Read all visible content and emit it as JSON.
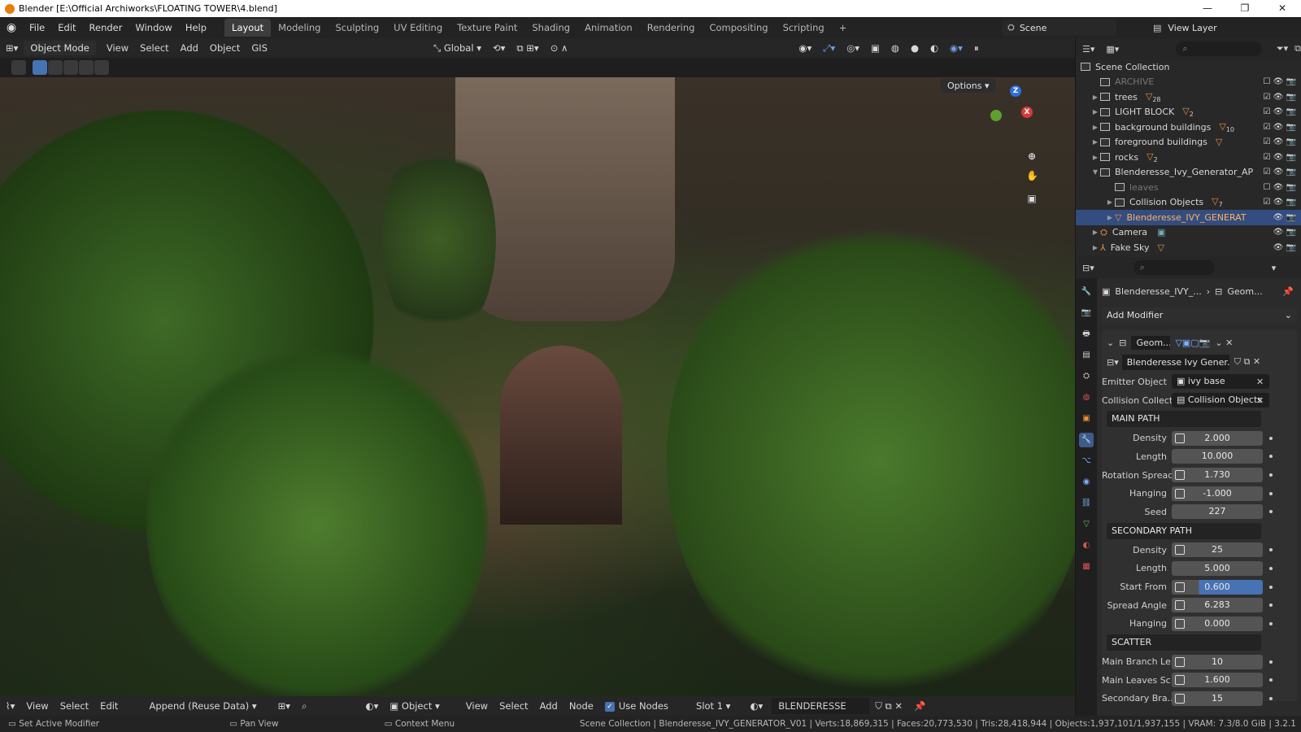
{
  "window": {
    "title": "Blender [E:\\Official Archiworks\\FLOATING TOWER\\4.blend]",
    "controls": [
      "—",
      "❐",
      "✕"
    ]
  },
  "menu": [
    "File",
    "Edit",
    "Render",
    "Window",
    "Help"
  ],
  "workspace_tabs": [
    {
      "label": "Layout",
      "active": true
    },
    {
      "label": "Modeling"
    },
    {
      "label": "Sculpting"
    },
    {
      "label": "UV Editing"
    },
    {
      "label": "Texture Paint"
    },
    {
      "label": "Shading"
    },
    {
      "label": "Animation"
    },
    {
      "label": "Rendering"
    },
    {
      "label": "Compositing"
    },
    {
      "label": "Scripting"
    },
    {
      "label": "+"
    }
  ],
  "scene": {
    "label": "Scene"
  },
  "view_layer": {
    "label": "View Layer"
  },
  "viewport_header": {
    "mode": "Object Mode",
    "menus": [
      "View",
      "Select",
      "Add",
      "Object",
      "GIS"
    ],
    "transform_orientation": "Global",
    "options_label": "Options"
  },
  "outliner": {
    "root": "Scene Collection",
    "rows": [
      {
        "label": "ARCHIVE",
        "dim": true
      },
      {
        "label": "trees",
        "count": "28"
      },
      {
        "label": "LIGHT BLOCK",
        "count": "2"
      },
      {
        "label": "background buildings",
        "count": "10"
      },
      {
        "label": "foreground buildings",
        "count": ""
      },
      {
        "label": "rocks",
        "count": "2"
      },
      {
        "label": "Blenderesse_Ivy_Generator_AP",
        "count": ""
      },
      {
        "label": "leaves",
        "dim": true
      },
      {
        "label": "Collision Objects",
        "count": "7"
      },
      {
        "label": "Blenderesse_IVY_GENERAT",
        "selected": true
      },
      {
        "label": "Camera",
        "count": ""
      },
      {
        "label": "Fake Sky",
        "count": ""
      }
    ]
  },
  "properties": {
    "breadcrumb_object": "Blenderesse_IVY_...",
    "breadcrumb_modifier": "Geom...",
    "add_modifier": "Add Modifier",
    "modifier_name": "Geom...",
    "node_group": "Blenderesse Ivy Gener...",
    "emitter_label": "Emitter Object",
    "emitter_value": "ivy base",
    "collision_label": "Collision Collect...",
    "collision_value": "Collision Objects",
    "sections": [
      {
        "title": "MAIN PATH",
        "fields": [
          {
            "label": "Density",
            "value": "2.000",
            "knob": true
          },
          {
            "label": "Length",
            "value": "10.000",
            "knob": false
          },
          {
            "label": "Rotation Spread",
            "value": "1.730",
            "knob": true
          },
          {
            "label": "Hanging",
            "value": "-1.000",
            "knob": true
          },
          {
            "label": "Seed",
            "value": "227",
            "knob": false
          }
        ]
      },
      {
        "title": "SECONDARY PATH",
        "fields": [
          {
            "label": "Density",
            "value": "25",
            "knob": true
          },
          {
            "label": "Length",
            "value": "5.000",
            "knob": false
          },
          {
            "label": "Start From",
            "value": "0.600",
            "knob": true,
            "active": true
          },
          {
            "label": "Spread Angle",
            "value": "6.283",
            "knob": true
          },
          {
            "label": "Hanging",
            "value": "0.000",
            "knob": true
          }
        ]
      },
      {
        "title": "SCATTER",
        "fields": [
          {
            "label": "Main Branch Le...",
            "value": "10",
            "knob": true
          },
          {
            "label": "Main Leaves Sc...",
            "value": "1.600",
            "knob": true
          },
          {
            "label": "Secondary Bra...",
            "value": "15",
            "knob": true
          }
        ]
      }
    ]
  },
  "node_header": {
    "menus": [
      "View",
      "Select",
      "Edit"
    ],
    "append_mode": "Append (Reuse Data)",
    "context": "Object",
    "menus2": [
      "View",
      "Select",
      "Add",
      "Node"
    ],
    "use_nodes": "Use Nodes",
    "slot": "Slot 1",
    "material": "BLENDERESSE"
  },
  "status": {
    "hint1": "Set Active Modifier",
    "hint2": "Pan View",
    "hint3": "Context Menu",
    "stats": "Scene Collection | Blenderesse_IVY_GENERATOR_V01 | Verts:18,869,315 | Faces:20,773,530 | Tris:28,418,944 | Objects:1,937,101/1,937,155 | VRAM: 7.3/8.0 GiB | 3.2.1"
  },
  "colors": {
    "accent": "#4772b3",
    "selection": "#334d80",
    "collection_orange": "#e8913c"
  }
}
